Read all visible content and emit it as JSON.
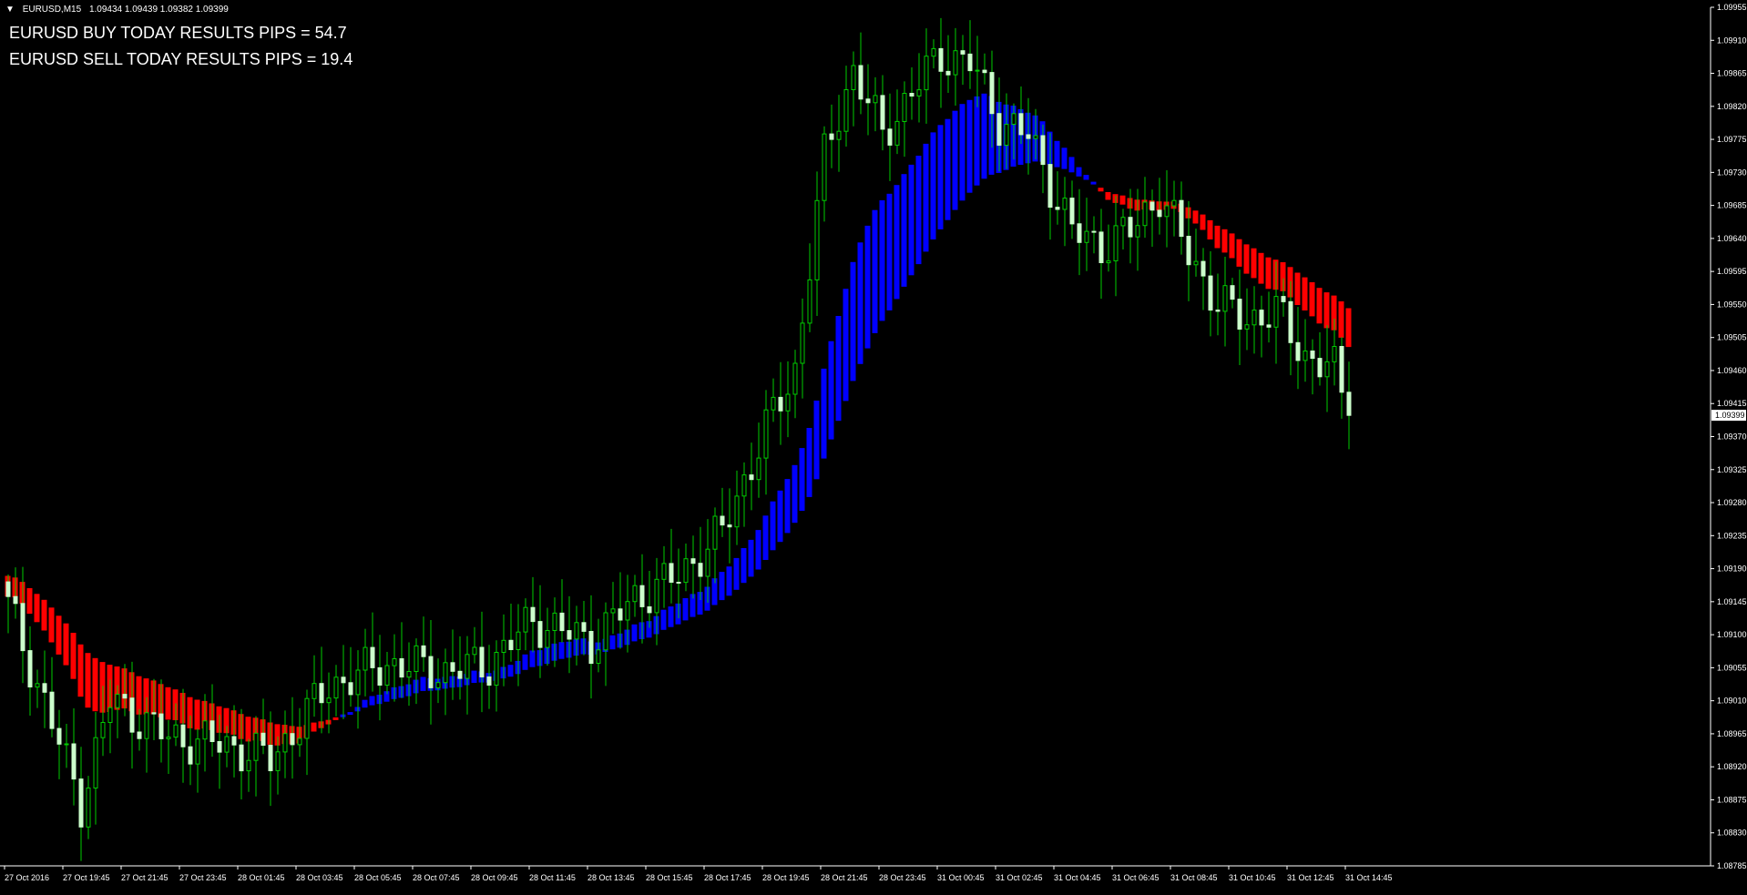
{
  "header": {
    "dropdown_icon": "triangle-down-icon",
    "symbol": "EURUSD,M15",
    "ohlc": "1.09434 1.09439 1.09382 1.09399"
  },
  "results": {
    "buy_text": "EURUSD BUY TODAY RESULTS PIPS = 54.7",
    "sell_text": "EURUSD SELL TODAY RESULTS PIPS = 19.4"
  },
  "colors": {
    "background": "#000000",
    "axis": "#ffffff",
    "candle_bull": "#ffffff",
    "candle_bear": "#ccffcc",
    "wick": "#00cc00",
    "ribbon_up": "#0000ff",
    "ribbon_down": "#ff0000"
  },
  "chart_data": {
    "type": "candlestick",
    "symbol": "EURUSD",
    "timeframe": "M15",
    "ylim": [
      1.08785,
      1.09955
    ],
    "y_ticks": [
      "1.09955",
      "1.09910",
      "1.09865",
      "1.09820",
      "1.09775",
      "1.09730",
      "1.09685",
      "1.09640",
      "1.09595",
      "1.09550",
      "1.09505",
      "1.09460",
      "1.09415",
      "1.09370",
      "1.09325",
      "1.09280",
      "1.09235",
      "1.09190",
      "1.09145",
      "1.09100",
      "1.09055",
      "1.09010",
      "1.08965",
      "1.08920",
      "1.08875",
      "1.08830",
      "1.08785"
    ],
    "current_price": "1.09399",
    "x_ticks": [
      "27 Oct 2016",
      "27 Oct 19:45",
      "27 Oct 21:45",
      "27 Oct 23:45",
      "28 Oct 01:45",
      "28 Oct 03:45",
      "28 Oct 05:45",
      "28 Oct 07:45",
      "28 Oct 09:45",
      "28 Oct 11:45",
      "28 Oct 13:45",
      "28 Oct 15:45",
      "28 Oct 17:45",
      "28 Oct 19:45",
      "28 Oct 21:45",
      "28 Oct 23:45",
      "31 Oct 00:45",
      "31 Oct 02:45",
      "31 Oct 04:45",
      "31 Oct 06:45",
      "31 Oct 08:45",
      "31 Oct 10:45",
      "31 Oct 12:45",
      "31 Oct 14:45"
    ],
    "bars_per_tick": 8,
    "close_anchors": [
      [
        0,
        1.0914
      ],
      [
        6,
        1.0898
      ],
      [
        10,
        1.0887
      ],
      [
        14,
        1.0901
      ],
      [
        22,
        1.0896
      ],
      [
        30,
        1.0895
      ],
      [
        36,
        1.0893
      ],
      [
        44,
        1.0903
      ],
      [
        52,
        1.0906
      ],
      [
        60,
        1.0905
      ],
      [
        66,
        1.0906
      ],
      [
        72,
        1.0912
      ],
      [
        80,
        1.0909
      ],
      [
        86,
        1.0915
      ],
      [
        92,
        1.0918
      ],
      [
        98,
        1.0924
      ],
      [
        104,
        1.0938
      ],
      [
        108,
        1.0946
      ],
      [
        112,
        1.0975
      ],
      [
        116,
        1.0987
      ],
      [
        120,
        1.0978
      ],
      [
        124,
        1.0984
      ],
      [
        128,
        1.0989
      ],
      [
        132,
        1.0988
      ],
      [
        136,
        1.098
      ],
      [
        140,
        1.0978
      ],
      [
        146,
        1.0965
      ],
      [
        150,
        1.0963
      ],
      [
        154,
        1.0965
      ],
      [
        158,
        1.097
      ],
      [
        162,
        1.0962
      ],
      [
        166,
        1.0955
      ],
      [
        170,
        1.0953
      ],
      [
        174,
        1.0954
      ],
      [
        178,
        1.0948
      ],
      [
        182,
        1.0946
      ],
      [
        184,
        1.09399
      ]
    ],
    "ribbon": [
      {
        "from": 0,
        "to": 6,
        "trend": "up",
        "upper_start": 1.092,
        "lower_start": 1.0916
      },
      {
        "from": 6,
        "to": 48,
        "trend": "down"
      },
      {
        "from": 48,
        "to": 160,
        "trend": "up",
        "upper_peak": 1.0977,
        "lower_peak": 1.0965
      },
      {
        "from": 160,
        "to": 184,
        "trend": "down",
        "upper_end": 1.0956,
        "lower_end": 1.0952
      }
    ]
  }
}
